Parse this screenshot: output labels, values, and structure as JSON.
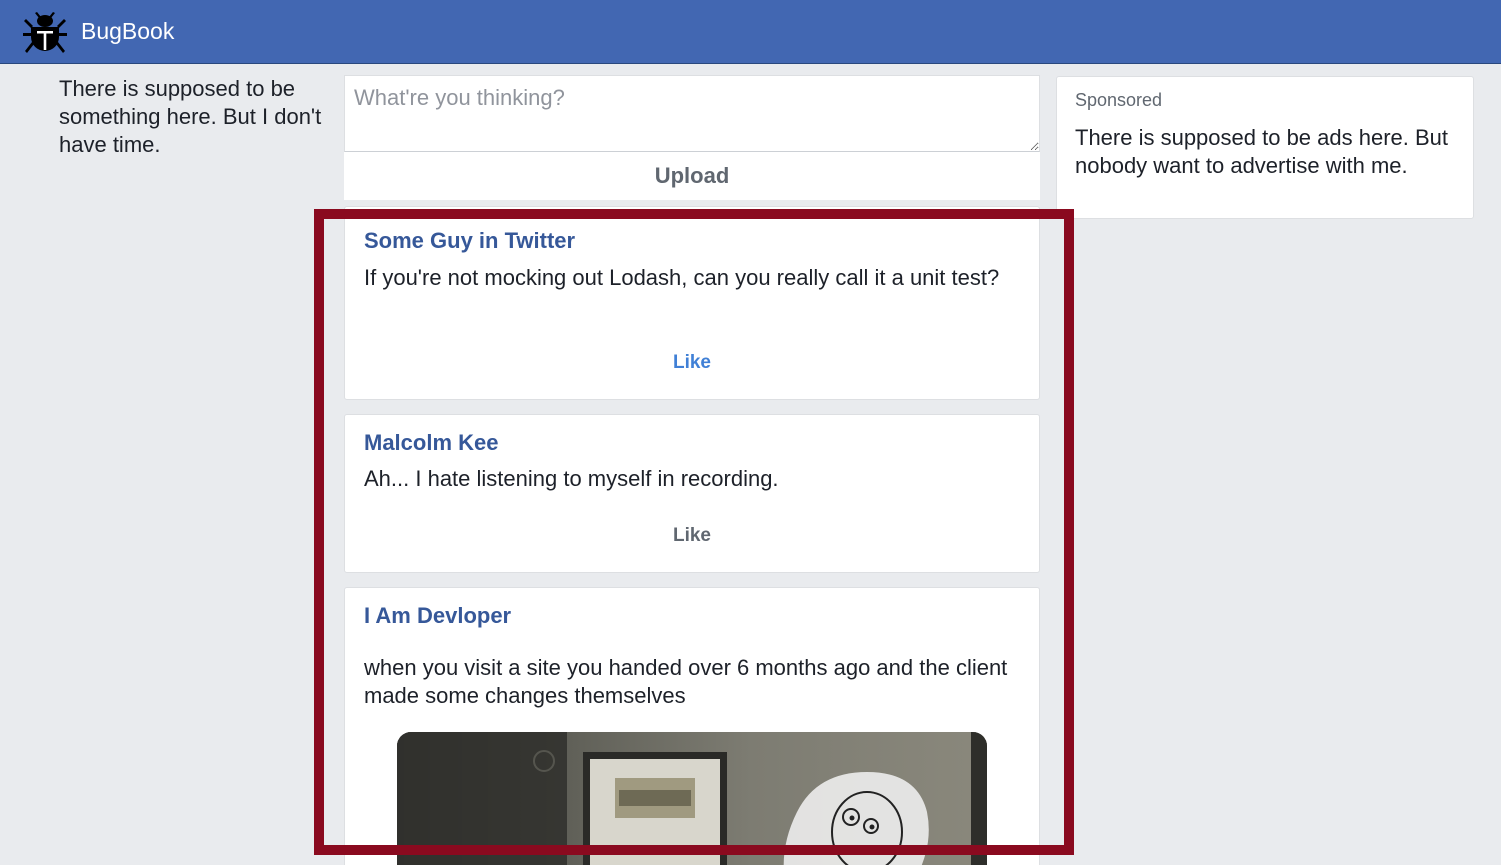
{
  "header": {
    "brand": "BugBook",
    "logo_icon": "bug-icon",
    "background_color": "#4267b2"
  },
  "left_column": {
    "text": "There is supposed to be something here. But I don't have time."
  },
  "composer": {
    "placeholder": "What're you thinking?",
    "value": "",
    "upload_label": "Upload"
  },
  "sponsored": {
    "label": "Sponsored",
    "text": "There is supposed to be ads here. But nobody want to advertise with me."
  },
  "posts": [
    {
      "author": "Some Guy in Twitter",
      "text": "If you're not mocking out Lodash, can you really call it a unit test?",
      "like_label": "Like",
      "liked": true
    },
    {
      "author": "Malcolm Kee",
      "text": "Ah... I hate listening to myself in recording.",
      "like_label": "Like",
      "liked": false
    },
    {
      "author": "I Am Devloper",
      "text": "when you visit a site you handed over 6 months ago and the client made some changes themselves",
      "has_image": true
    }
  ],
  "colors": {
    "author": "#365899",
    "like_active": "#4080d6",
    "like_idle": "#606770",
    "highlight_border": "#8a0a1f"
  }
}
